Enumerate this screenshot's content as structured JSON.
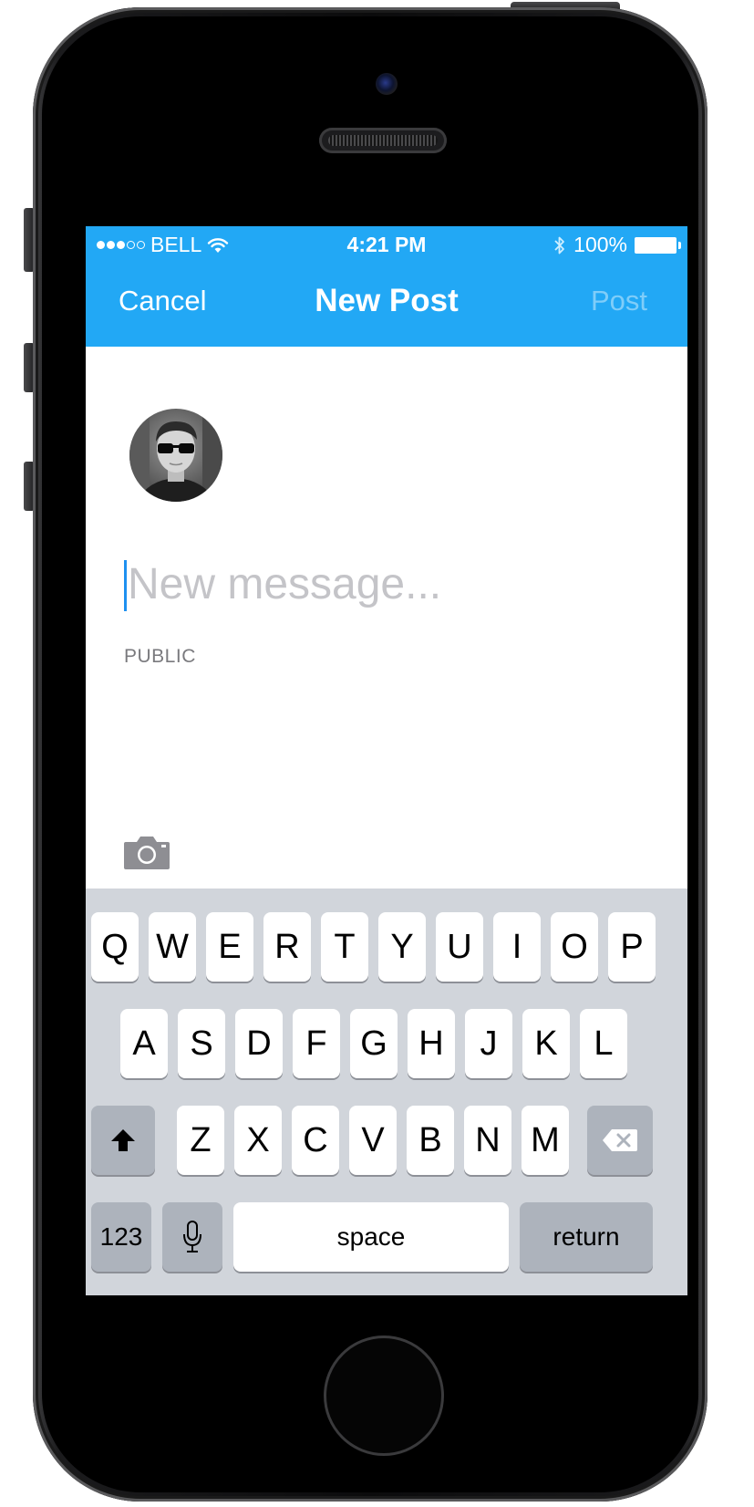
{
  "status_bar": {
    "carrier": "BELL",
    "time": "4:21 PM",
    "battery": "100%",
    "signal_full": 3,
    "signal_empty": 2
  },
  "nav": {
    "cancel_label": "Cancel",
    "title": "New Post",
    "post_label": "Post"
  },
  "composer": {
    "placeholder": "New message...",
    "value": "",
    "audience": "PUBLIC"
  },
  "keyboard": {
    "row1": [
      "Q",
      "W",
      "E",
      "R",
      "T",
      "Y",
      "U",
      "I",
      "O",
      "P"
    ],
    "row2": [
      "A",
      "S",
      "D",
      "F",
      "G",
      "H",
      "J",
      "K",
      "L"
    ],
    "row3": [
      "Z",
      "X",
      "C",
      "V",
      "B",
      "N",
      "M"
    ],
    "numbers_label": "123",
    "space_label": "space",
    "return_label": "return"
  },
  "icons": {
    "wifi": "wifi-icon",
    "bluetooth": "bluetooth-icon",
    "battery": "battery-icon",
    "camera": "camera-icon",
    "shift": "shift-icon",
    "backspace": "backspace-icon",
    "microphone": "microphone-icon"
  },
  "colors": {
    "accent": "#22a8f5",
    "post_disabled": "#7fcdf9",
    "keyboard_bg": "#d1d5db",
    "key_dark": "#adb3bc"
  }
}
